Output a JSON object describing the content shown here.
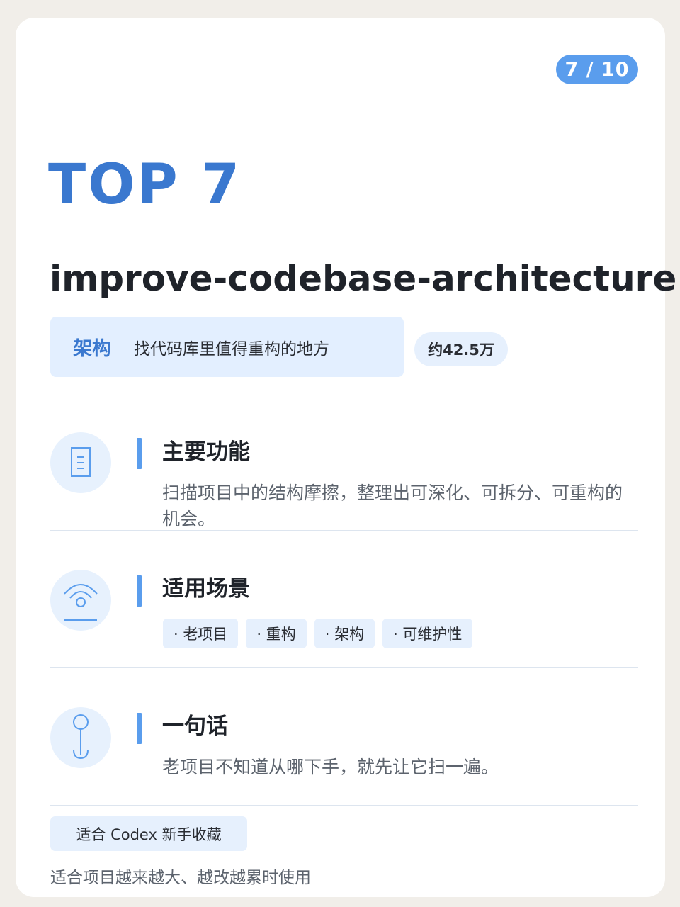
{
  "page": {
    "indicator": "7 / 10"
  },
  "rank": "TOP 7",
  "skill": {
    "name": "improve-codebase-architecture",
    "category": "架构",
    "description": "找代码库里值得重构的地方",
    "count": "约42.5万"
  },
  "sections": {
    "features": {
      "icon": "document-icon",
      "title": "主要功能",
      "text": "扫描项目中的结构摩擦，整理出可深化、可拆分、可重构的机会。"
    },
    "scenarios": {
      "icon": "signal-icon",
      "title": "适用场景",
      "tags": [
        "· 老项目",
        "· 重构",
        "· 架构",
        "· 可维护性"
      ]
    },
    "summary": {
      "icon": "pin-icon",
      "title": "一句话",
      "text": "老项目不知道从哪下手，就先让它扫一遍。"
    }
  },
  "footer": {
    "chip": "适合 Codex 新手收藏",
    "note": "适合项目越来越大、越改越累时使用"
  },
  "colors": {
    "accent": "#3a78cf",
    "badge": "#5a9ded",
    "tint": "#e6f0fd",
    "background": "#f1eee9"
  }
}
